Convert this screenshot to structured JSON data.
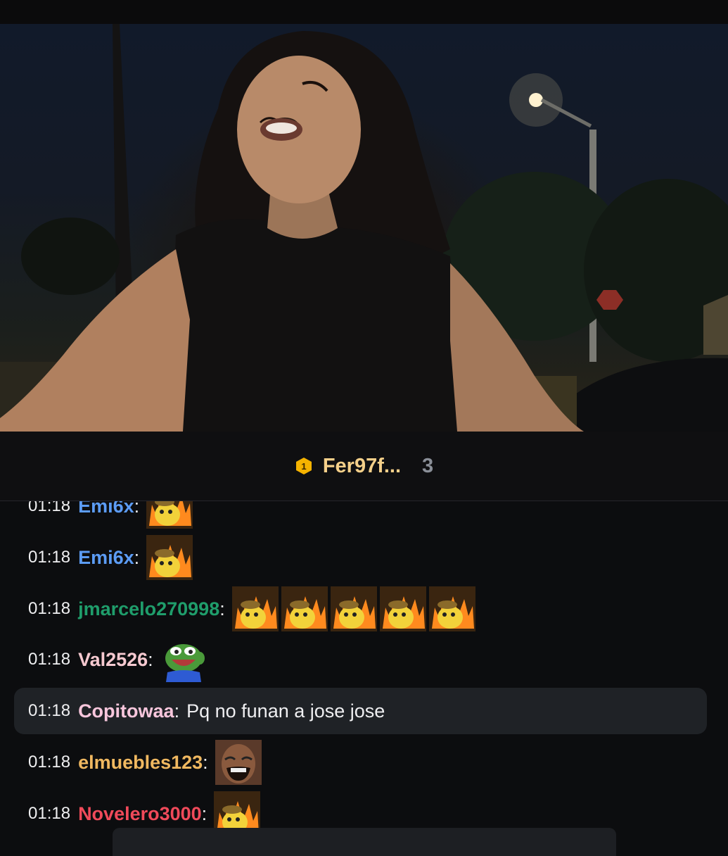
{
  "leaderboard": {
    "rank": "1",
    "name": "Fer97f...",
    "count": "3"
  },
  "messages": [
    {
      "time": "01:18",
      "user": "Emi6x",
      "color": "#5c9cf5",
      "emotes": [
        "this-is-fine-emote"
      ],
      "text": ""
    },
    {
      "time": "01:18",
      "user": "Emi6x",
      "color": "#5c9cf5",
      "emotes": [
        "this-is-fine-emote"
      ],
      "text": ""
    },
    {
      "time": "01:18",
      "user": "jmarcelo270998",
      "color": "#1f9d6b",
      "emotes": [
        "this-is-fine-emote",
        "this-is-fine-emote",
        "this-is-fine-emote",
        "this-is-fine-emote",
        "this-is-fine-emote"
      ],
      "text": ""
    },
    {
      "time": "01:18",
      "user": "Val2526",
      "color": "#f6c9d0",
      "emotes": [
        "pepe-laugh-emote"
      ],
      "text": ""
    },
    {
      "time": "01:18",
      "user": "Copitowaa",
      "color": "#f7c6dc",
      "emotes": [],
      "text": "Pq no funan a jose jose"
    },
    {
      "time": "01:18",
      "user": "elmuebles123",
      "color": "#f0b860",
      "emotes": [
        "laughing-man-emote"
      ],
      "text": ""
    },
    {
      "time": "01:18",
      "user": "Novelero3000",
      "color": "#f04a5a",
      "emotes": [
        "this-is-fine-emote"
      ],
      "text": ""
    }
  ],
  "colors": {
    "background": "#0c0d0f",
    "highlight": "#1f2226",
    "coin": "#f5b300"
  }
}
